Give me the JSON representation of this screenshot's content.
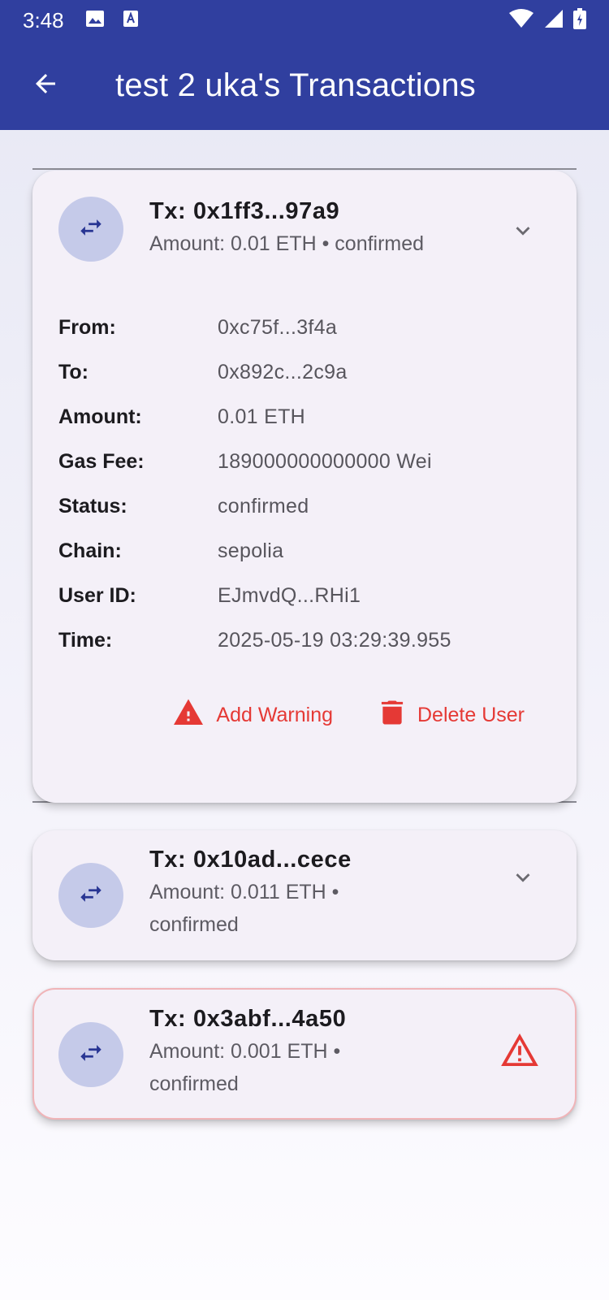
{
  "status_bar": {
    "time": "3:48",
    "icons": [
      "image-icon",
      "font-icon",
      "wifi-icon",
      "signal-icon",
      "battery-icon"
    ]
  },
  "app_bar": {
    "title": "test 2 uka's Transactions",
    "back_icon": "arrow-back-icon"
  },
  "colors": {
    "app_bar": "#303f9f",
    "avatar_bg": "#c5cae9",
    "danger": "#e53935",
    "card_bg": "#f4f0f8"
  },
  "transactions": [
    {
      "title": "Tx: 0x1ff3...97a9",
      "subtitle": "Amount: 0.01 ETH • confirmed",
      "expanded": true,
      "trailing_icon": "chevron-up-icon",
      "details": [
        {
          "label": "From:",
          "value": "0xc75f...3f4a"
        },
        {
          "label": "To:",
          "value": "0x892c...2c9a"
        },
        {
          "label": "Amount:",
          "value": "0.01 ETH"
        },
        {
          "label": "Gas Fee:",
          "value": "189000000000000 Wei"
        },
        {
          "label": "Status:",
          "value": "confirmed"
        },
        {
          "label": "Chain:",
          "value": "sepolia"
        },
        {
          "label": "User ID:",
          "value": "EJmvdQ...RHi1"
        },
        {
          "label": "Time:",
          "value": "2025-05-19 03:29:39.955"
        }
      ],
      "actions": {
        "add_warning": "Add Warning",
        "delete_user": "Delete User"
      }
    },
    {
      "title": "Tx: 0x10ad...cece",
      "subtitle": "Amount: 0.011 ETH • confirmed",
      "expanded": false,
      "trailing_icon": "chevron-down-icon"
    },
    {
      "title": "Tx: 0x3abf...4a50",
      "subtitle": "Amount: 0.001 ETH • confirmed",
      "expanded": false,
      "warning": true,
      "trailing_icon": "warning-icon"
    }
  ]
}
